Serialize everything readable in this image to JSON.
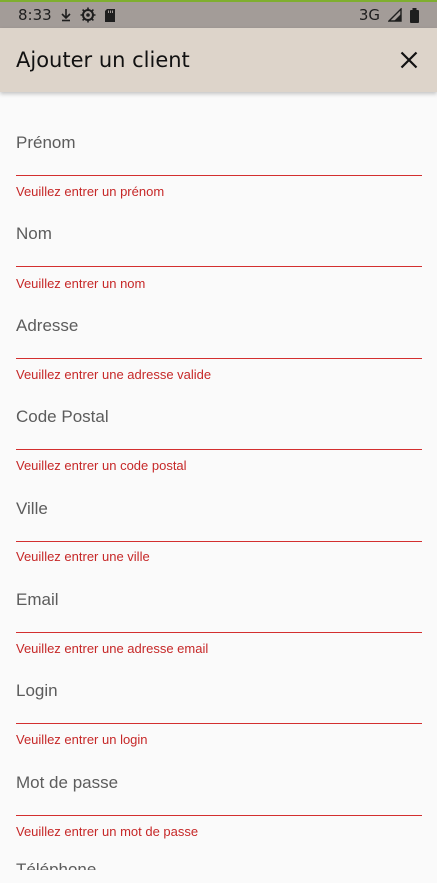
{
  "status_bar": {
    "time": "8:33",
    "network": "3G",
    "icons_left": [
      "download-icon",
      "settings-icon",
      "sd-card-icon"
    ],
    "icons_right": [
      "signal-icon",
      "battery-icon"
    ]
  },
  "app_bar": {
    "title": "Ajouter un client",
    "close_icon": "close-icon"
  },
  "form": {
    "fields": [
      {
        "label": "Prénom",
        "error": "Veuillez entrer un prénom"
      },
      {
        "label": "Nom",
        "error": "Veuillez entrer un nom"
      },
      {
        "label": "Adresse",
        "error": "Veuillez entrer une adresse valide"
      },
      {
        "label": "Code Postal",
        "error": "Veuillez entrer un code postal"
      },
      {
        "label": "Ville",
        "error": "Veuillez entrer une ville"
      },
      {
        "label": "Email",
        "error": "Veuillez entrer une adresse email"
      },
      {
        "label": "Login",
        "error": "Veuillez entrer un login"
      },
      {
        "label": "Mot de passe",
        "error": "Veuillez entrer un mot de passe"
      }
    ],
    "partial_label": "Téléphone"
  },
  "colors": {
    "app_bar": "#ddd4ca",
    "status_bar": "#a39c98",
    "error": "#d32f2f",
    "background": "#fafafa"
  }
}
